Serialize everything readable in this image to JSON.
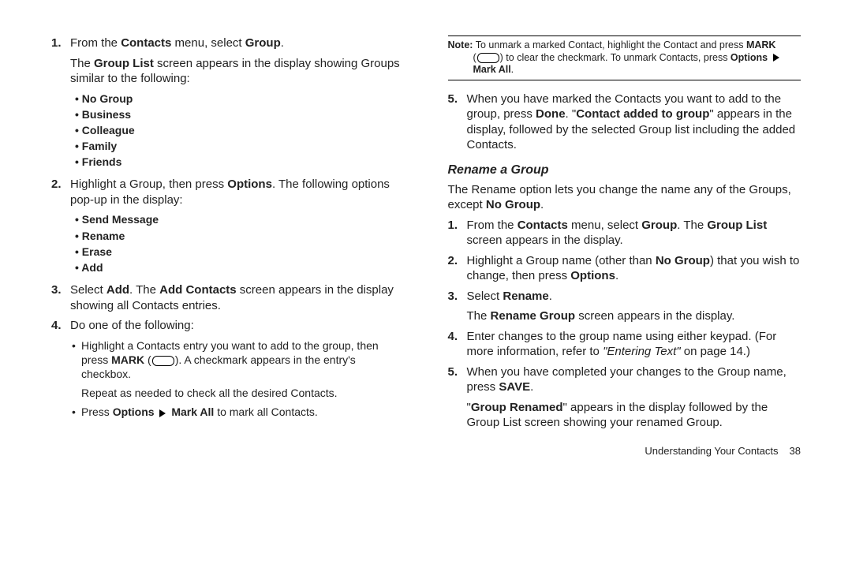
{
  "left": {
    "s1_a": "From the ",
    "s1_b": "Contacts",
    "s1_c": " menu, select ",
    "s1_d": "Group",
    "s1_e": ".",
    "s1p2_a": "The ",
    "s1p2_b": "Group List",
    "s1p2_c": " screen appears in the display showing Groups similar to the following:",
    "groups": [
      "No Group",
      "Business",
      "Colleague",
      "Family",
      "Friends"
    ],
    "s2_a": "Highlight a Group, then press ",
    "s2_b": "Options",
    "s2_c": ". The following options pop-up in the display:",
    "options": [
      "Send Message",
      "Rename",
      "Erase",
      "Add"
    ],
    "s3_a": "Select ",
    "s3_b": "Add",
    "s3_c": ". The ",
    "s3_d": "Add Contacts",
    "s3_e": " screen appears in the display showing all Contacts entries.",
    "s4": "Do one of the following:",
    "s4b1_a": "Highlight a Contacts entry you want to add to the group, then press ",
    "s4b1_b": "MARK",
    "s4b1_c": " (",
    "s4b1_d": "). A checkmark appears in the entry's checkbox.",
    "s4b1_r": "Repeat as needed to check all the desired Contacts.",
    "s4b2_a": "Press ",
    "s4b2_b": "Options",
    "s4b2_c": " ",
    "s4b2_d": "Mark All",
    "s4b2_e": " to mark all Contacts."
  },
  "right": {
    "note_a": "Note:",
    "note_b": " To unmark a marked Contact, highlight the Contact and press ",
    "note_c": "MARK",
    "note_d": " (",
    "note_e": ") to clear the checkmark. To unmark Contacts, press ",
    "note_f": "Options",
    "note_g": " ",
    "note_h": "Mark All",
    "note_i": ".",
    "s5_a": "When you have marked the Contacts you want to add to the group, press ",
    "s5_b": "Done",
    "s5_c": ". \"",
    "s5_d": "Contact added to group",
    "s5_e": "\" appears in the display, followed by the selected Group list including the added Contacts.",
    "heading": "Rename a Group",
    "intro_a": "The Rename option lets you change the name any of the Groups, except ",
    "intro_b": "No Group",
    "intro_c": ".",
    "r1_a": "From the ",
    "r1_b": "Contacts",
    "r1_c": " menu, select ",
    "r1_d": "Group",
    "r1_e": ". The ",
    "r1_f": "Group List",
    "r1_g": " screen appears in the display.",
    "r2_a": "Highlight a Group name (other than ",
    "r2_b": "No Group",
    "r2_c": ") that you wish to change, then press ",
    "r2_d": "Options",
    "r2_e": ".",
    "r3_a": "Select ",
    "r3_b": "Rename",
    "r3_c": ".",
    "r3p2_a": "The ",
    "r3p2_b": "Rename Group",
    "r3p2_c": " screen appears in the display.",
    "r4_a": "Enter changes to the group name using either keypad. (For more information, refer to ",
    "r4_b": "\"Entering Text\"",
    "r4_c": "  on page 14.)",
    "r5_a": "When you have completed your changes to the Group name, press ",
    "r5_b": "SAVE",
    "r5_c": ".",
    "r5p2_a": "\"",
    "r5p2_b": "Group Renamed",
    "r5p2_c": "\" appears in the display followed by the Group List screen showing your renamed Group."
  },
  "footer": {
    "section": "Understanding Your Contacts",
    "page": "38"
  }
}
